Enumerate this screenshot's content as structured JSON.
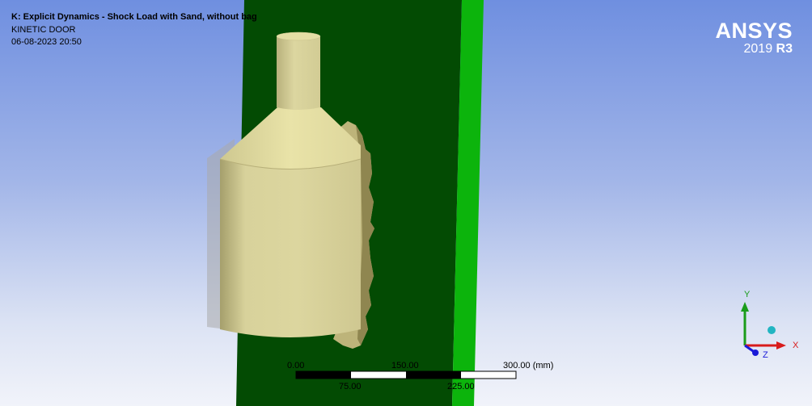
{
  "header": {
    "title": "K: Explicit Dynamics - Shock Load with Sand, without bag",
    "subtitle": "KINETIC DOOR",
    "datestamp": "06-08-2023 20:50"
  },
  "logo": {
    "name": "ANSYS",
    "version_year": "2019",
    "version_release": "R3"
  },
  "scale_bar": {
    "top_labels": [
      "0.00",
      "150.00",
      "300.00 (mm)"
    ],
    "bottom_labels": [
      "75.00",
      "225.00"
    ]
  },
  "triad": {
    "y_label": "Y",
    "x_label": "X",
    "z_label": "Z"
  },
  "colors": {
    "door_panel": "#034b03",
    "door_edge": "#0cb40c",
    "body": "#d9d39a",
    "ghost": "#a8a8a8"
  }
}
